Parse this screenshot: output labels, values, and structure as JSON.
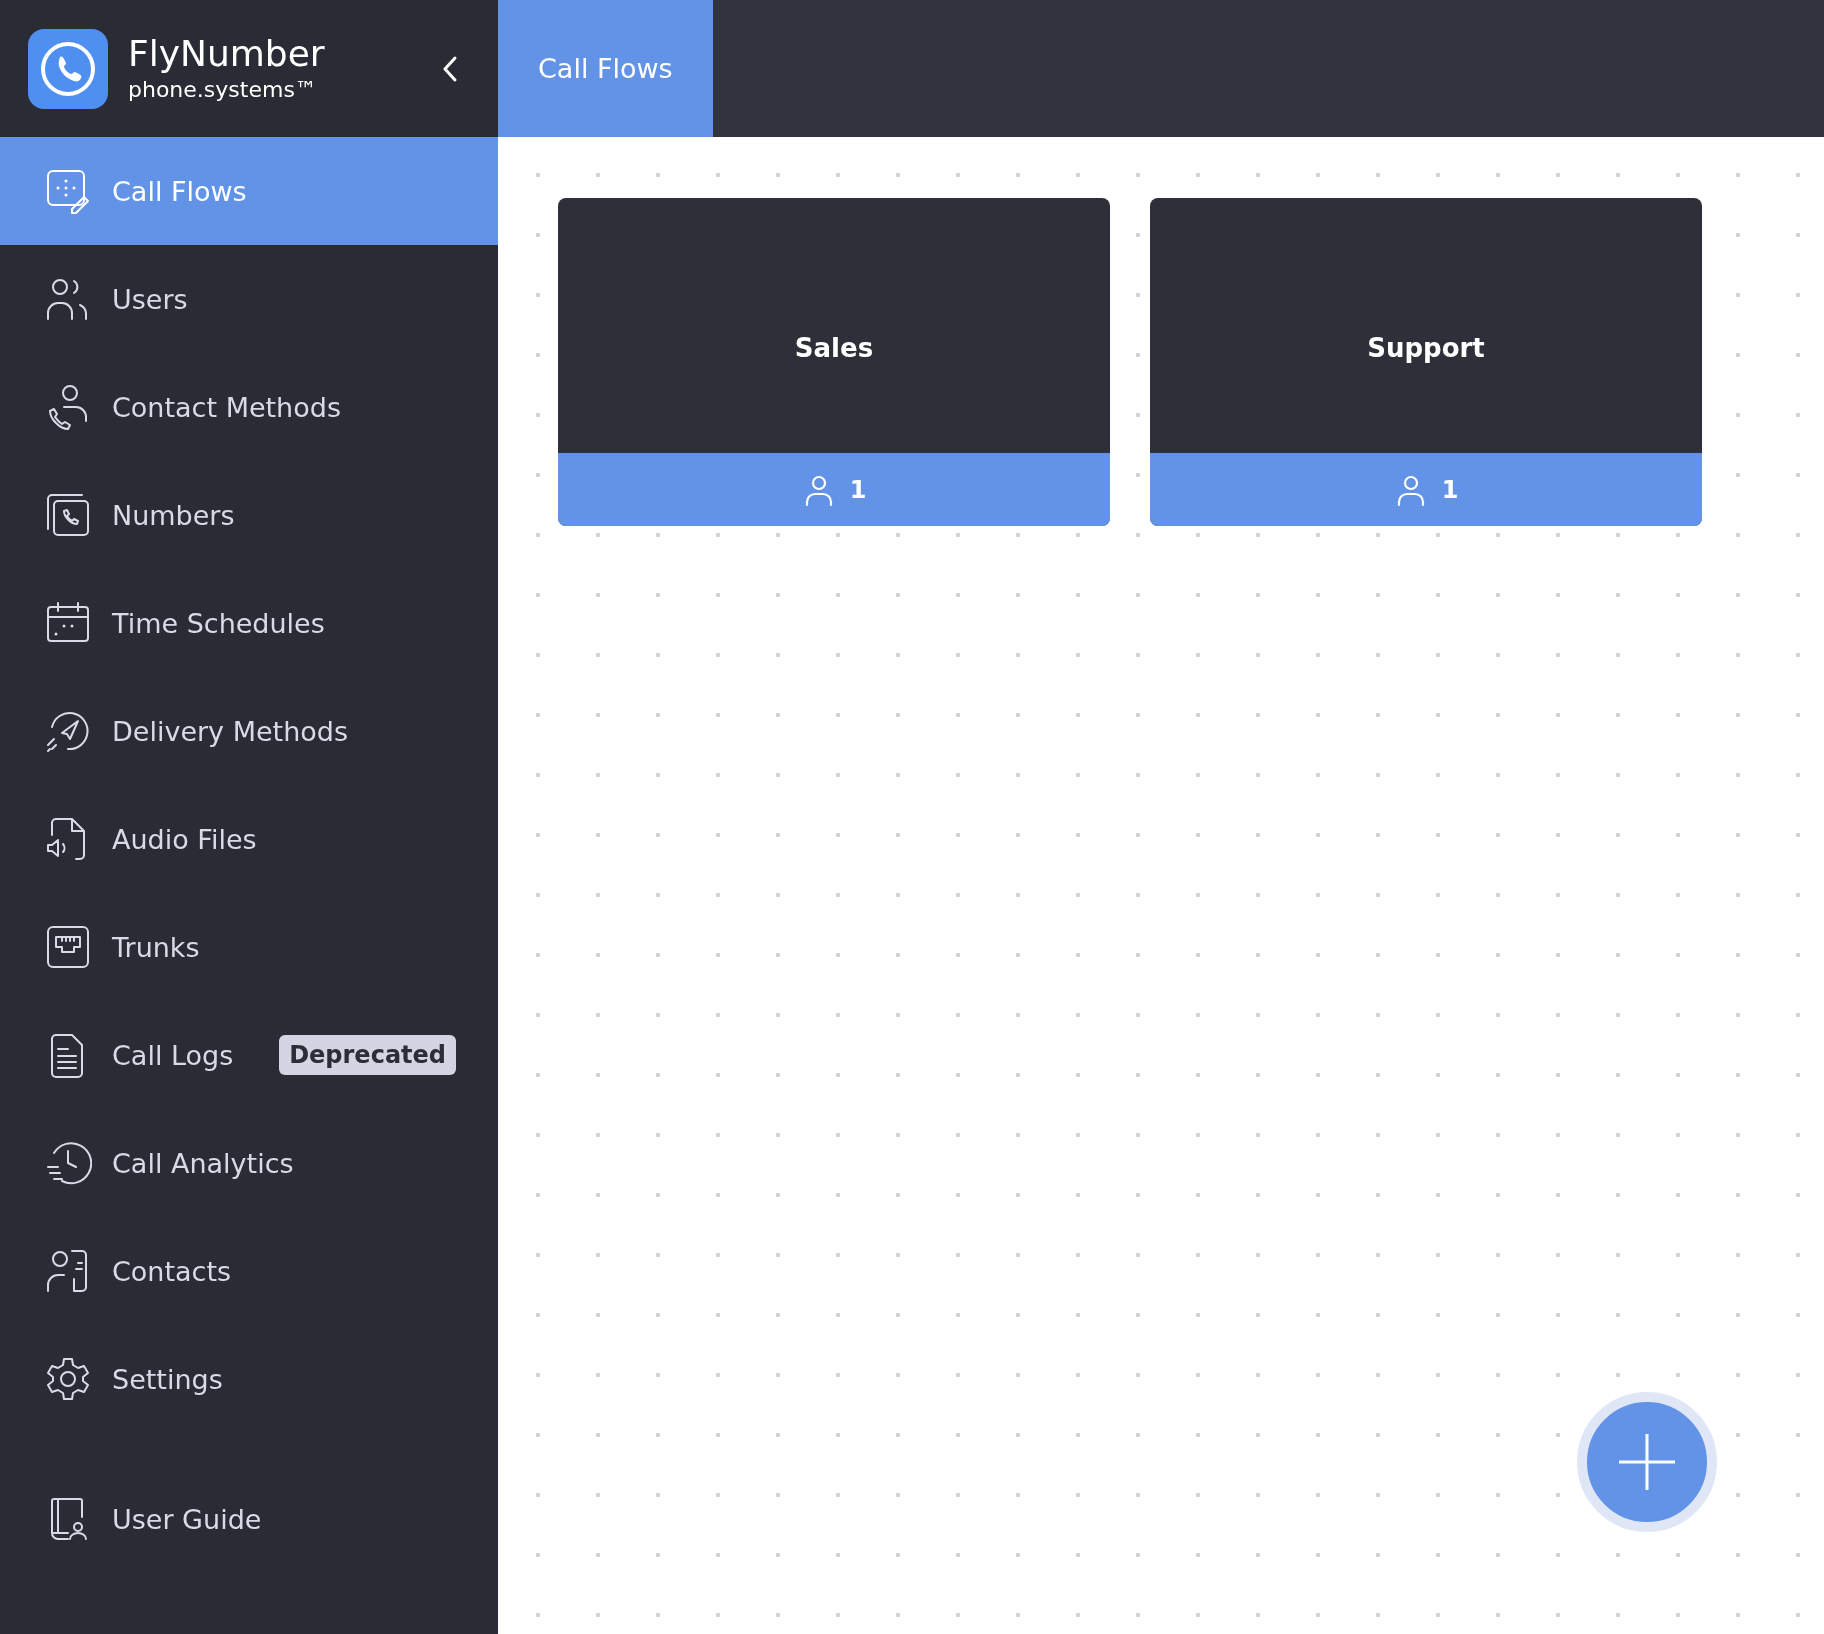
{
  "brand": {
    "name": "FlyNumber",
    "tagline": "phone.systems™"
  },
  "tabs": [
    {
      "label": "Call Flows",
      "selected": true
    }
  ],
  "sidebar": {
    "items": [
      {
        "label": "Call Flows",
        "selected": true
      },
      {
        "label": "Users",
        "selected": false
      },
      {
        "label": "Contact Methods",
        "selected": false
      },
      {
        "label": "Numbers",
        "selected": false
      },
      {
        "label": "Time Schedules",
        "selected": false
      },
      {
        "label": "Delivery Methods",
        "selected": false
      },
      {
        "label": "Audio Files",
        "selected": false
      },
      {
        "label": "Trunks",
        "selected": false
      },
      {
        "label": "Call Logs",
        "selected": false,
        "badge": "Deprecated"
      },
      {
        "label": "Call Analytics",
        "selected": false
      },
      {
        "label": "Contacts",
        "selected": false
      },
      {
        "label": "Settings",
        "selected": false
      }
    ],
    "footer_items": [
      {
        "label": "User Guide",
        "selected": false
      }
    ]
  },
  "call_flows": [
    {
      "name": "Sales",
      "users": "1"
    },
    {
      "name": "Support",
      "users": "1"
    }
  ]
}
